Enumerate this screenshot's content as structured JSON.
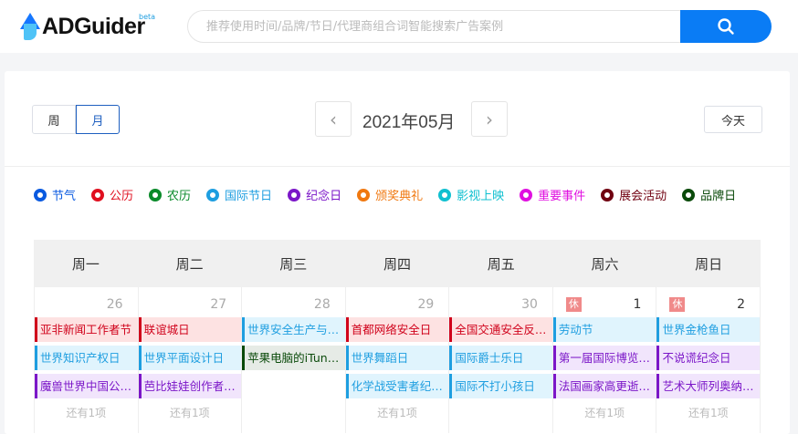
{
  "header": {
    "logo_text": "ADGuider",
    "logo_badge": "beta",
    "search_placeholder": "推荐使用时间/品牌/节日/代理商组合词智能搜索广告案例"
  },
  "toolbar": {
    "view_week": "周",
    "view_month": "月",
    "active_view": "月",
    "month_title": "2021年05月",
    "today_label": "今天"
  },
  "legend": [
    {
      "label": "节气",
      "color": "#0a5ae0"
    },
    {
      "label": "公历",
      "color": "#e01020"
    },
    {
      "label": "农历",
      "color": "#0a8a2a"
    },
    {
      "label": "国际节日",
      "color": "#1e9ee0"
    },
    {
      "label": "纪念日",
      "color": "#7b16c8"
    },
    {
      "label": "颁奖典礼",
      "color": "#f07810"
    },
    {
      "label": "影视上映",
      "color": "#10c0d0"
    },
    {
      "label": "重要事件",
      "color": "#e010e0"
    },
    {
      "label": "展会活动",
      "color": "#700010"
    },
    {
      "label": "品牌日",
      "color": "#0a4a0a"
    }
  ],
  "weekdays": [
    "周一",
    "周二",
    "周三",
    "周四",
    "周五",
    "周六",
    "周日"
  ],
  "rest_badge": "休",
  "week": [
    {
      "day": "26",
      "rest": false,
      "current": false,
      "events": [
        {
          "t": "亚非新闻工作者节",
          "c": "red"
        },
        {
          "t": "世界知识产权日",
          "c": "blue"
        },
        {
          "t": "魔兽世界中国公测纪念日",
          "c": "purple"
        }
      ],
      "more": "还有1项"
    },
    {
      "day": "27",
      "rest": false,
      "current": false,
      "events": [
        {
          "t": "联谊城日",
          "c": "red"
        },
        {
          "t": "世界平面设计日",
          "c": "blue"
        },
        {
          "t": "芭比娃娃创作者露丝诞辰",
          "c": "purple"
        }
      ],
      "more": "还有1项"
    },
    {
      "day": "28",
      "rest": false,
      "current": false,
      "events": [
        {
          "t": "世界安全生产与健康日",
          "c": "blue"
        },
        {
          "t": "苹果电脑的iTunes音乐商店上线",
          "c": "brand"
        }
      ],
      "more": ""
    },
    {
      "day": "29",
      "rest": false,
      "current": false,
      "events": [
        {
          "t": "首都网络安全日",
          "c": "red"
        },
        {
          "t": "世界舞蹈日",
          "c": "blue"
        },
        {
          "t": "化学战受害者纪念日",
          "c": "blue"
        }
      ],
      "more": "还有1项"
    },
    {
      "day": "30",
      "rest": false,
      "current": false,
      "events": [
        {
          "t": "全国交通安全反思日",
          "c": "red"
        },
        {
          "t": "国际爵士乐日",
          "c": "blue"
        },
        {
          "t": "国际不打小孩日",
          "c": "blue"
        }
      ],
      "more": ""
    },
    {
      "day": "1",
      "rest": true,
      "current": true,
      "events": [
        {
          "t": "劳动节",
          "c": "blue"
        },
        {
          "t": "第一届国际博览会开幕",
          "c": "purple"
        },
        {
          "t": "法国画家高更逝世纪念日",
          "c": "purple"
        }
      ],
      "more": "还有1项"
    },
    {
      "day": "2",
      "rest": true,
      "current": true,
      "events": [
        {
          "t": "世界金枪鱼日",
          "c": "blue"
        },
        {
          "t": "不说谎纪念日",
          "c": "purple"
        },
        {
          "t": "艺术大师列奥纳多逝世纪念日",
          "c": "purple"
        }
      ],
      "more": "还有1项"
    }
  ]
}
